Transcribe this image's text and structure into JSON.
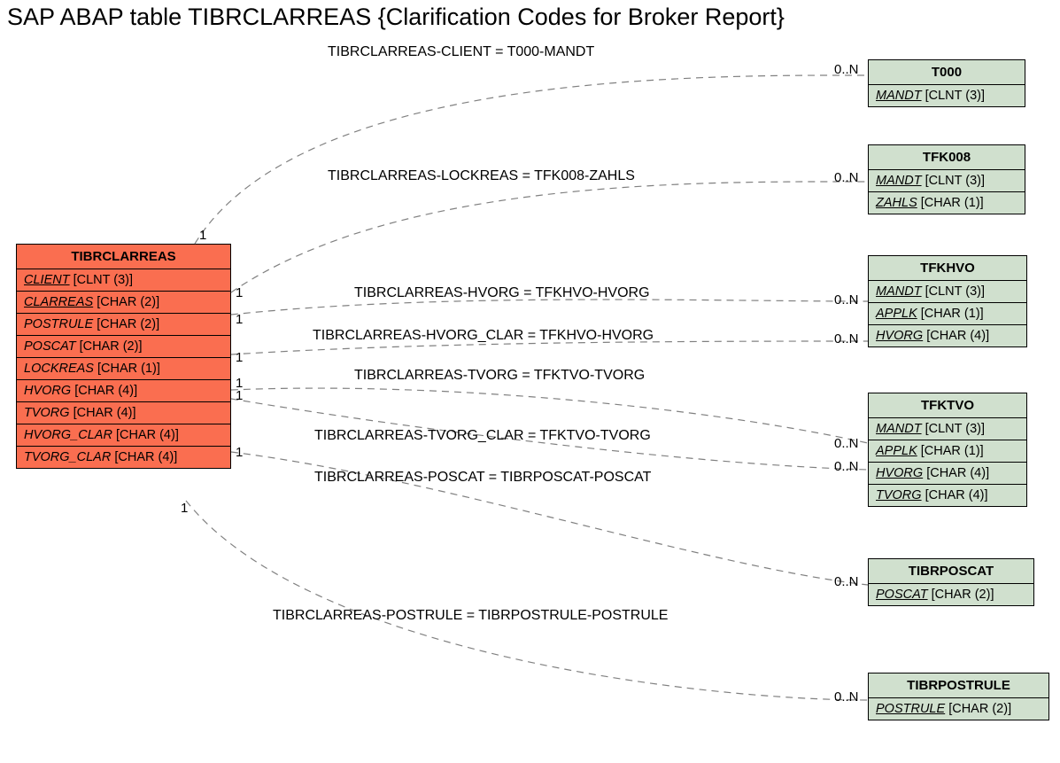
{
  "title": "SAP ABAP table TIBRCLARREAS {Clarification Codes for Broker Report}",
  "main": {
    "name": "TIBRCLARREAS",
    "fields": [
      {
        "name": "CLIENT",
        "type": "[CLNT (3)]",
        "underline": true
      },
      {
        "name": "CLARREAS",
        "type": "[CHAR (2)]",
        "underline": true
      },
      {
        "name": "POSTRULE",
        "type": "[CHAR (2)]",
        "underline": false
      },
      {
        "name": "POSCAT",
        "type": "[CHAR (2)]",
        "underline": false
      },
      {
        "name": "LOCKREAS",
        "type": "[CHAR (1)]",
        "underline": false
      },
      {
        "name": "HVORG",
        "type": "[CHAR (4)]",
        "underline": false
      },
      {
        "name": "TVORG",
        "type": "[CHAR (4)]",
        "underline": false
      },
      {
        "name": "HVORG_CLAR",
        "type": "[CHAR (4)]",
        "underline": false
      },
      {
        "name": "TVORG_CLAR",
        "type": "[CHAR (4)]",
        "underline": false
      }
    ]
  },
  "refs": {
    "t000": {
      "name": "T000",
      "fields": [
        {
          "name": "MANDT",
          "type": "[CLNT (3)]",
          "underline": true
        }
      ]
    },
    "tfk008": {
      "name": "TFK008",
      "fields": [
        {
          "name": "MANDT",
          "type": "[CLNT (3)]",
          "underline": true
        },
        {
          "name": "ZAHLS",
          "type": "[CHAR (1)]",
          "underline": true
        }
      ]
    },
    "tfkhvo": {
      "name": "TFKHVO",
      "fields": [
        {
          "name": "MANDT",
          "type": "[CLNT (3)]",
          "underline": true
        },
        {
          "name": "APPLK",
          "type": "[CHAR (1)]",
          "underline": true
        },
        {
          "name": "HVORG",
          "type": "[CHAR (4)]",
          "underline": true
        }
      ]
    },
    "tfktvo": {
      "name": "TFKTVO",
      "fields": [
        {
          "name": "MANDT",
          "type": "[CLNT (3)]",
          "underline": true
        },
        {
          "name": "APPLK",
          "type": "[CHAR (1)]",
          "underline": true
        },
        {
          "name": "HVORG",
          "type": "[CHAR (4)]",
          "underline": true
        },
        {
          "name": "TVORG",
          "type": "[CHAR (4)]",
          "underline": true
        }
      ]
    },
    "tibrposcat": {
      "name": "TIBRPOSCAT",
      "fields": [
        {
          "name": "POSCAT",
          "type": "[CHAR (2)]",
          "underline": true
        }
      ]
    },
    "tibrpostrule": {
      "name": "TIBRPOSTRULE",
      "fields": [
        {
          "name": "POSTRULE",
          "type": "[CHAR (2)]",
          "underline": true
        }
      ]
    }
  },
  "edges": {
    "e1": {
      "label": "TIBRCLARREAS-CLIENT = T000-MANDT",
      "left": "1",
      "right": "0..N"
    },
    "e2": {
      "label": "TIBRCLARREAS-LOCKREAS = TFK008-ZAHLS",
      "left": "1",
      "right": "0..N"
    },
    "e3": {
      "label": "TIBRCLARREAS-HVORG = TFKHVO-HVORG",
      "left": "1",
      "right": "0..N"
    },
    "e4": {
      "label": "TIBRCLARREAS-HVORG_CLAR = TFKHVO-HVORG",
      "left": "1",
      "right": "0..N"
    },
    "e5": {
      "label": "TIBRCLARREAS-TVORG = TFKTVO-TVORG",
      "left": "1",
      "right": "0..N"
    },
    "e6": {
      "label": "TIBRCLARREAS-TVORG_CLAR = TFKTVO-TVORG",
      "left": "1",
      "right": "0..N"
    },
    "e7": {
      "label": "TIBRCLARREAS-POSCAT = TIBRPOSCAT-POSCAT",
      "left": "1",
      "right": "0..N"
    },
    "e8": {
      "label": "TIBRCLARREAS-POSTRULE = TIBRPOSTRULE-POSTRULE",
      "left": "1",
      "right": "0..N"
    }
  }
}
